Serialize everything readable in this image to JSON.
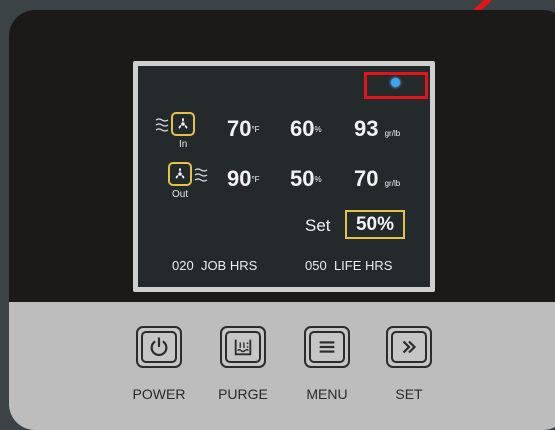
{
  "display": {
    "in": {
      "label": "In",
      "temperature": "70",
      "temperature_unit": "°F",
      "humidity": "60",
      "humidity_unit": "%",
      "grains": "93",
      "grains_unit": "gr/lb"
    },
    "out": {
      "label": "Out",
      "temperature": "90",
      "temperature_unit": "°F",
      "humidity": "50",
      "humidity_unit": "%",
      "grains": "70",
      "grains_unit": "gr/lb"
    },
    "set_label": "Set",
    "set_value": "50%",
    "job_hrs_value": "020",
    "job_hrs_label": "JOB HRS",
    "life_hrs_value": "050",
    "life_hrs_label": "LIFE HRS"
  },
  "buttons": [
    {
      "label": "POWER",
      "icon": "power-icon"
    },
    {
      "label": "PURGE",
      "icon": "purge-icon"
    },
    {
      "label": "MENU",
      "icon": "menu-icon"
    },
    {
      "label": "SET",
      "icon": "double-chevron-right-icon"
    }
  ],
  "colors": {
    "accent": "#e4c24a",
    "highlight": "#e3131b",
    "wifi": "#3aa6ff"
  }
}
